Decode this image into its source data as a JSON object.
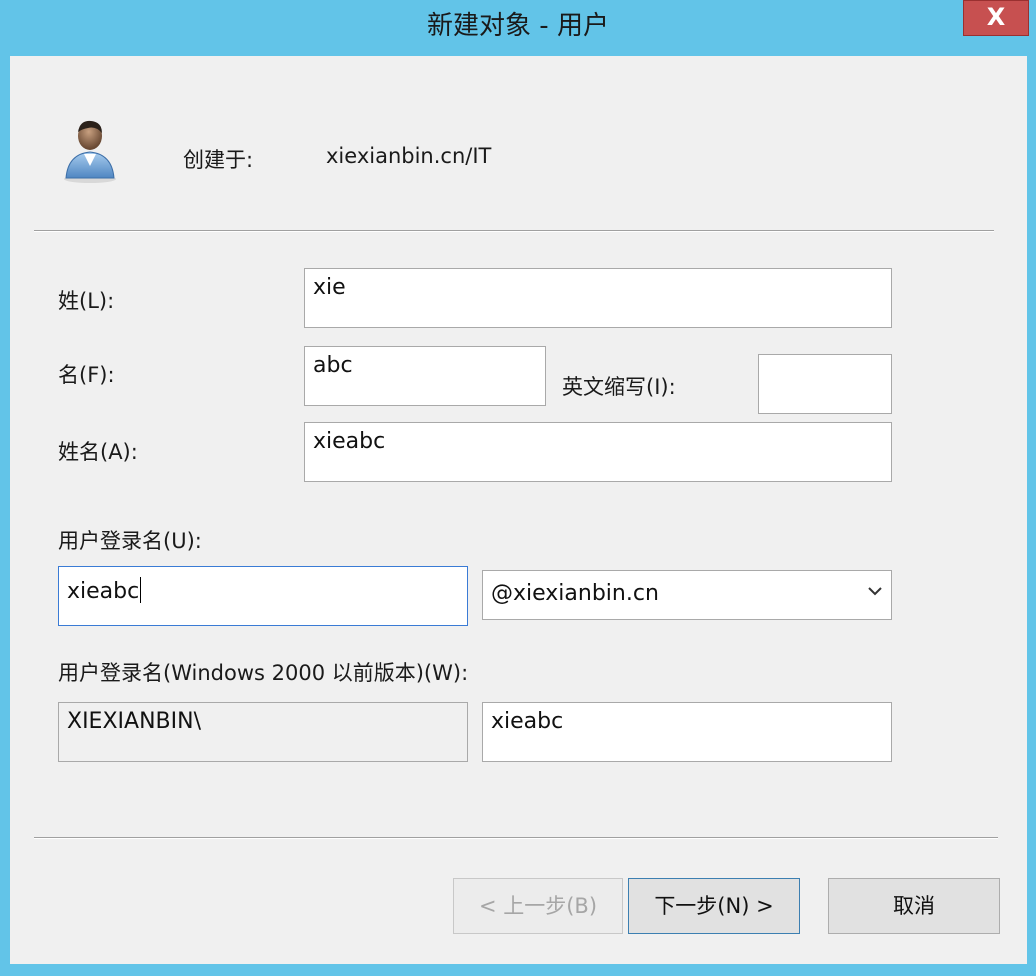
{
  "window": {
    "title": "新建对象 - 用户",
    "close_label": "X"
  },
  "header": {
    "icon": "user-icon",
    "created_in_label": "创建于:",
    "created_in_value": "xiexianbin.cn/IT"
  },
  "form": {
    "last_name_label": "姓(L):",
    "last_name_value": "xie",
    "first_name_label": "名(F):",
    "first_name_value": "abc",
    "initials_label": "英文缩写(I):",
    "initials_value": "",
    "full_name_label": "姓名(A):",
    "full_name_value": "xieabc",
    "logon_label": "用户登录名(U):",
    "logon_value": "xieabc",
    "domain_value": "@xiexianbin.cn",
    "pre2000_label": "用户登录名(Windows 2000 以前版本)(W):",
    "pre2000_domain": "XIEXIANBIN\\",
    "pre2000_value": "xieabc"
  },
  "buttons": {
    "back": "< 上一步(B)",
    "next": "下一步(N) >",
    "cancel": "取消"
  },
  "colors": {
    "titlebar": "#62c4e8",
    "close": "#c75050",
    "client": "#f0f0f0"
  }
}
